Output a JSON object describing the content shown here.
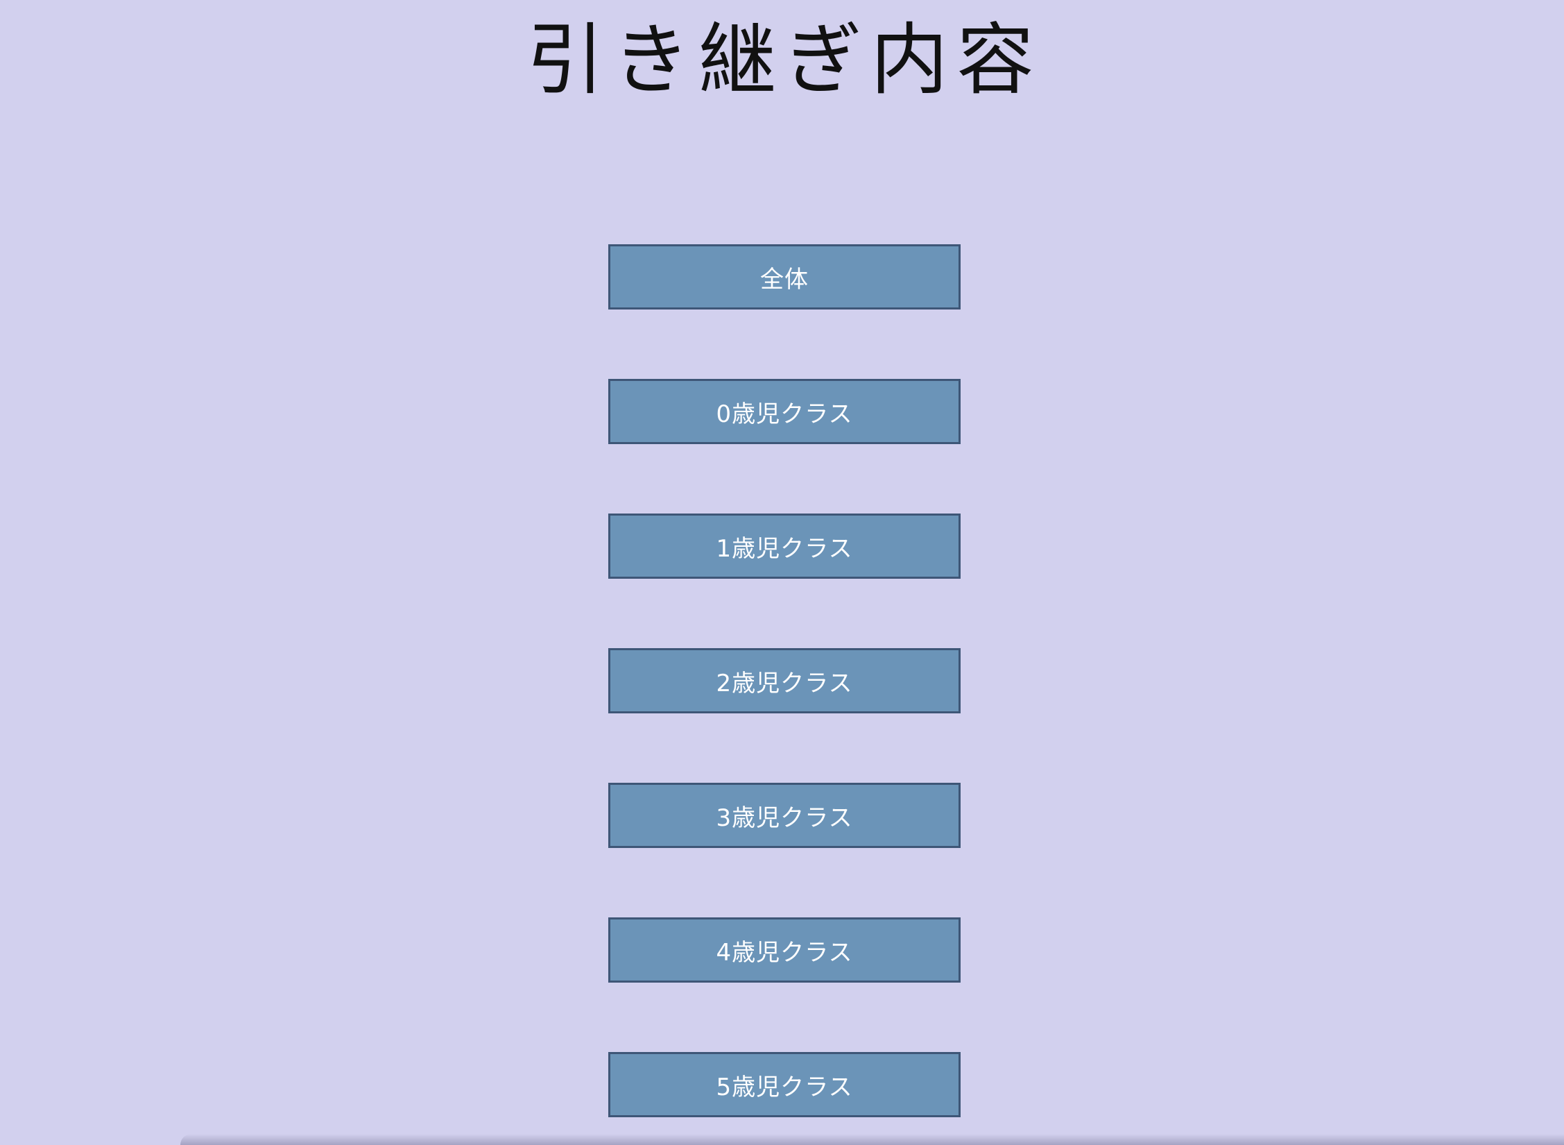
{
  "page": {
    "title": "引き継ぎ内容"
  },
  "menu": {
    "items": [
      {
        "label": "全体"
      },
      {
        "label": "0歳児クラス"
      },
      {
        "label": "1歳児クラス"
      },
      {
        "label": "2歳児クラス"
      },
      {
        "label": "3歳児クラス"
      },
      {
        "label": "4歳児クラス"
      },
      {
        "label": "5歳児クラス"
      }
    ]
  },
  "colors": {
    "background": "#d2d0ee",
    "button_fill": "#6b94b8",
    "button_border": "#3e5677",
    "button_text": "#ffffff",
    "title_text": "#111111"
  }
}
